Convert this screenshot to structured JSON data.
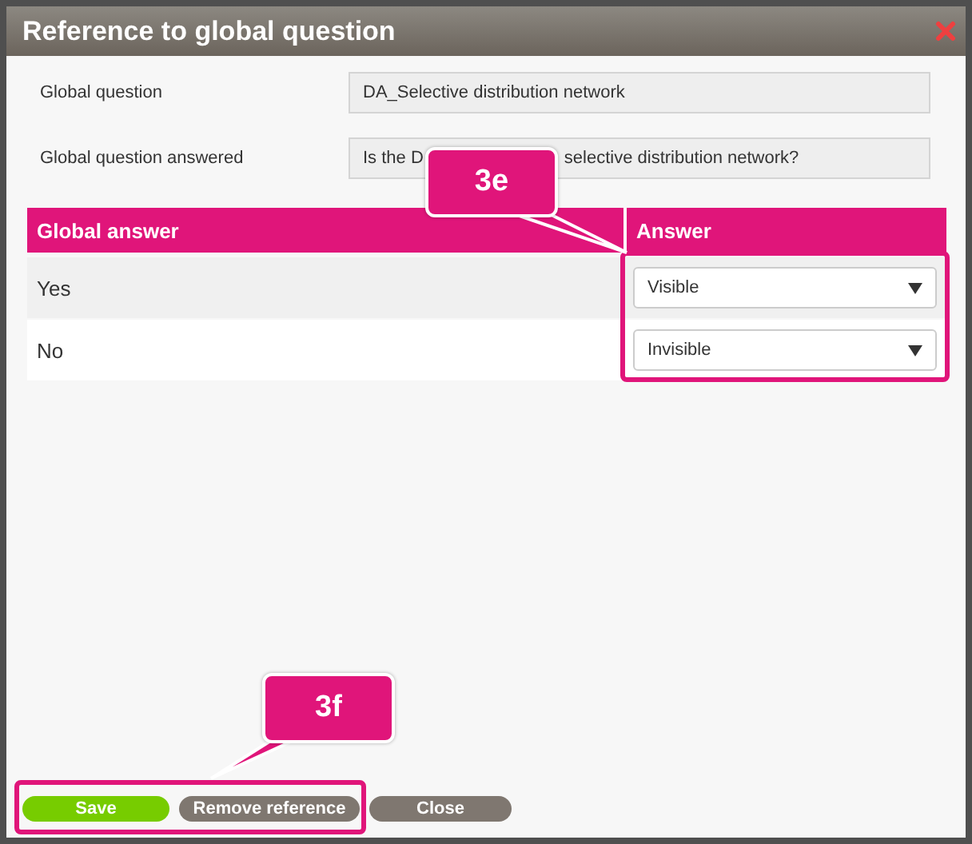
{
  "window": {
    "title": "Reference to global question"
  },
  "fields": [
    {
      "label": "Global question",
      "value_parts": [
        "DA_Selective distribution network"
      ]
    },
    {
      "label": "Global question answered",
      "value_parts": [
        "Is the D",
        "selective distribution network?"
      ]
    }
  ],
  "table": {
    "columns": [
      "Global answer",
      "Answer"
    ],
    "rows": [
      {
        "global_answer": "Yes",
        "answer": "Visible"
      },
      {
        "global_answer": "No",
        "answer": "Invisible"
      }
    ]
  },
  "buttons": [
    {
      "label": "Save",
      "kind": "primary"
    },
    {
      "label": "Remove reference",
      "kind": "secondary"
    },
    {
      "label": "Close",
      "kind": "secondary"
    }
  ],
  "callouts": [
    {
      "label": "3e"
    },
    {
      "label": "3f"
    }
  ]
}
